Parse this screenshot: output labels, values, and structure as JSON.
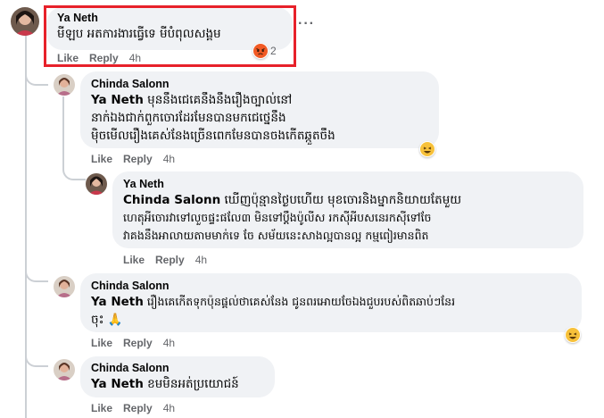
{
  "comments": [
    {
      "author": "Ya Neth",
      "text": "មីឡប អតការងារធ្វើទេ មីបំពុលសង្គម",
      "actions": {
        "like": "Like",
        "reply": "Reply",
        "time": "4h"
      },
      "reaction": {
        "icon": "angry-emoji",
        "count": "2"
      }
    },
    {
      "author": "Chinda Salonn",
      "mention": "Ya Neth",
      "lines": [
        "មុននឹងជេគេនឹងនឹងរឿងច្បាល់នៅ",
        "នាក់ឯងជាក់ពួកចោរដែរមែនបានមកជេថ្នេនឹង",
        "ម៉ិចមើលរឿងគេស់នែងច្រើនពេកមែនបានចងកើតឆ្កួតចឹង"
      ],
      "actions": {
        "like": "Like",
        "reply": "Reply",
        "time": "4h"
      },
      "reaction": {
        "icon": "laughing-emoji"
      }
    },
    {
      "author": "Ya Neth",
      "mention": "Chinda Salonn",
      "lines": [
        "ឃើញប៉ុន្មានថ្ងៃបហើយ មុខចោរនិងម្នាកនិយាយតែមួយ",
        "ហេតុអីចោរវាទៅលួចផ្ទះផលែ៣ មិនទៅប្ដឹងប៉ូលីស រកស៊ីអីបសនេរកស៊ីទៅចែ",
        "វាគងនឹងអាលាយតាមមាក់ទេ ចែ សម័យនេះសាងល្អបានល្អ កម្មពៀរមានពិត"
      ],
      "actions": {
        "like": "Like",
        "reply": "Reply",
        "time": "4h"
      }
    },
    {
      "author": "Chinda Salonn",
      "mention": "Ya Neth",
      "lines": [
        "រឿងគេកើតទុកប៉ុនផ្តល់ថាគេស់នែង ជូនពរអោយចែឯងជួបរបស់ពិតឆាប់ៗនែរ",
        "ចុះ 🙏"
      ],
      "actions": {
        "like": "Like",
        "reply": "Reply",
        "time": "4h"
      },
      "reaction": {
        "icon": "laughing-emoji"
      }
    },
    {
      "author": "Chinda Salonn",
      "mention": "Ya Neth",
      "lines": [
        "ខមមិនអត់ប្រយោជន៍"
      ],
      "actions": {
        "like": "Like",
        "reply": "Reply",
        "time": "4h"
      }
    }
  ],
  "more_icon": "more-dots-icon",
  "highlight_color": "#e7212a"
}
